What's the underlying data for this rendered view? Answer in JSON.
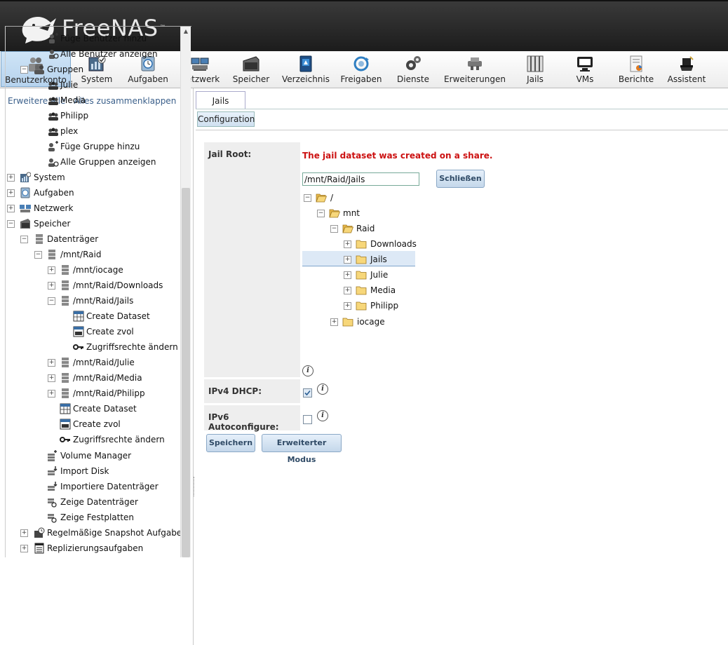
{
  "app": {
    "name": "FreeNAS"
  },
  "toolbar": [
    {
      "label": "Benutzerkonto",
      "icon": "users-icon",
      "active": true
    },
    {
      "label": "System",
      "icon": "system-icon"
    },
    {
      "label": "Aufgaben",
      "icon": "tasks-icon"
    },
    {
      "label": "Netzwerk",
      "icon": "network-icon"
    },
    {
      "label": "Speicher",
      "icon": "storage-icon"
    },
    {
      "label": "Verzeichnis",
      "icon": "directory-icon"
    },
    {
      "label": "Freigaben",
      "icon": "shares-icon"
    },
    {
      "label": "Dienste",
      "icon": "services-icon"
    },
    {
      "label": "Erweiterungen",
      "icon": "plugins-icon"
    },
    {
      "label": "Jails",
      "icon": "jails-icon"
    },
    {
      "label": "VMs",
      "icon": "vms-icon"
    },
    {
      "label": "Berichte",
      "icon": "reports-icon"
    },
    {
      "label": "Assistent",
      "icon": "wizard-icon"
    }
  ],
  "sidebar": {
    "expand_all": "Erweitere alle",
    "collapse_all": "Alles zusammenklappen",
    "items": [
      {
        "label": "Füge Benutzer hinzu",
        "icon": "add-user-icon"
      },
      {
        "label": "Alle Benutzer anzeigen",
        "icon": "view-users-icon"
      },
      {
        "label": "Gruppen",
        "icon": "group-icon"
      },
      {
        "label": "Julie",
        "icon": "group-icon"
      },
      {
        "label": "Media",
        "icon": "group-icon"
      },
      {
        "label": "Philipp",
        "icon": "group-icon"
      },
      {
        "label": "plex",
        "icon": "group-icon"
      },
      {
        "label": "Füge Gruppe hinzu",
        "icon": "add-group-icon"
      },
      {
        "label": "Alle Gruppen anzeigen",
        "icon": "view-groups-icon"
      },
      {
        "label": "System",
        "icon": "system-icon"
      },
      {
        "label": "Aufgaben",
        "icon": "tasks-icon"
      },
      {
        "label": "Netzwerk",
        "icon": "network-icon"
      },
      {
        "label": "Speicher",
        "icon": "storage-icon"
      },
      {
        "label": "Datenträger",
        "icon": "volume-icon"
      },
      {
        "label": "/mnt/Raid",
        "icon": "volume-icon"
      },
      {
        "label": "/mnt/iocage",
        "icon": "volume-icon"
      },
      {
        "label": "/mnt/Raid/Downloads",
        "icon": "volume-icon"
      },
      {
        "label": "/mnt/Raid/Jails",
        "icon": "volume-icon"
      },
      {
        "label": "Create Dataset",
        "icon": "create-dataset-icon"
      },
      {
        "label": "Create zvol",
        "icon": "create-zvol-icon"
      },
      {
        "label": "Zugriffsrechte ändern",
        "icon": "key-icon"
      },
      {
        "label": "/mnt/Raid/Julie",
        "icon": "volume-icon"
      },
      {
        "label": "/mnt/Raid/Media",
        "icon": "volume-icon"
      },
      {
        "label": "/mnt/Raid/Philipp",
        "icon": "volume-icon"
      },
      {
        "label": "Create Dataset",
        "icon": "create-dataset-icon"
      },
      {
        "label": "Create zvol",
        "icon": "create-zvol-icon"
      },
      {
        "label": "Zugriffsrechte ändern",
        "icon": "key-icon"
      },
      {
        "label": "Volume Manager",
        "icon": "volume-manager-icon"
      },
      {
        "label": "Import Disk",
        "icon": "import-disk-icon"
      },
      {
        "label": "Importiere Datenträger",
        "icon": "import-volume-icon"
      },
      {
        "label": "Zeige Datenträger",
        "icon": "view-volumes-icon"
      },
      {
        "label": "Zeige Festplatten",
        "icon": "view-disks-icon"
      },
      {
        "label": "Regelmäßige Snapshot Aufgaben",
        "icon": "snapshot-icon"
      },
      {
        "label": "Replizierungsaufgaben",
        "icon": "replication-icon"
      }
    ]
  },
  "tabs": {
    "main": "Jails",
    "sub": "Configuration"
  },
  "form": {
    "jail_root_label": "Jail Root:",
    "error": "The jail dataset was created on a share.",
    "path_value": "/mnt/Raid/Jails",
    "close_button": "Schließen",
    "ipv4_label": "IPv4 DHCP:",
    "ipv4_checked": true,
    "ipv6_label": "IPv6 Autoconfigure:",
    "ipv6_checked": false,
    "save_button": "Speichern",
    "advanced_button": "Erweiterter Modus"
  },
  "file_tree": [
    {
      "label": "/",
      "icon": "folder-open-icon"
    },
    {
      "label": "mnt",
      "icon": "folder-open-icon"
    },
    {
      "label": "Raid",
      "icon": "folder-open-icon"
    },
    {
      "label": "Downloads",
      "icon": "folder-icon"
    },
    {
      "label": "Jails",
      "icon": "folder-icon"
    },
    {
      "label": "Julie",
      "icon": "folder-icon"
    },
    {
      "label": "Media",
      "icon": "folder-icon"
    },
    {
      "label": "Philipp",
      "icon": "folder-icon"
    },
    {
      "label": "iocage",
      "icon": "folder-icon"
    }
  ]
}
